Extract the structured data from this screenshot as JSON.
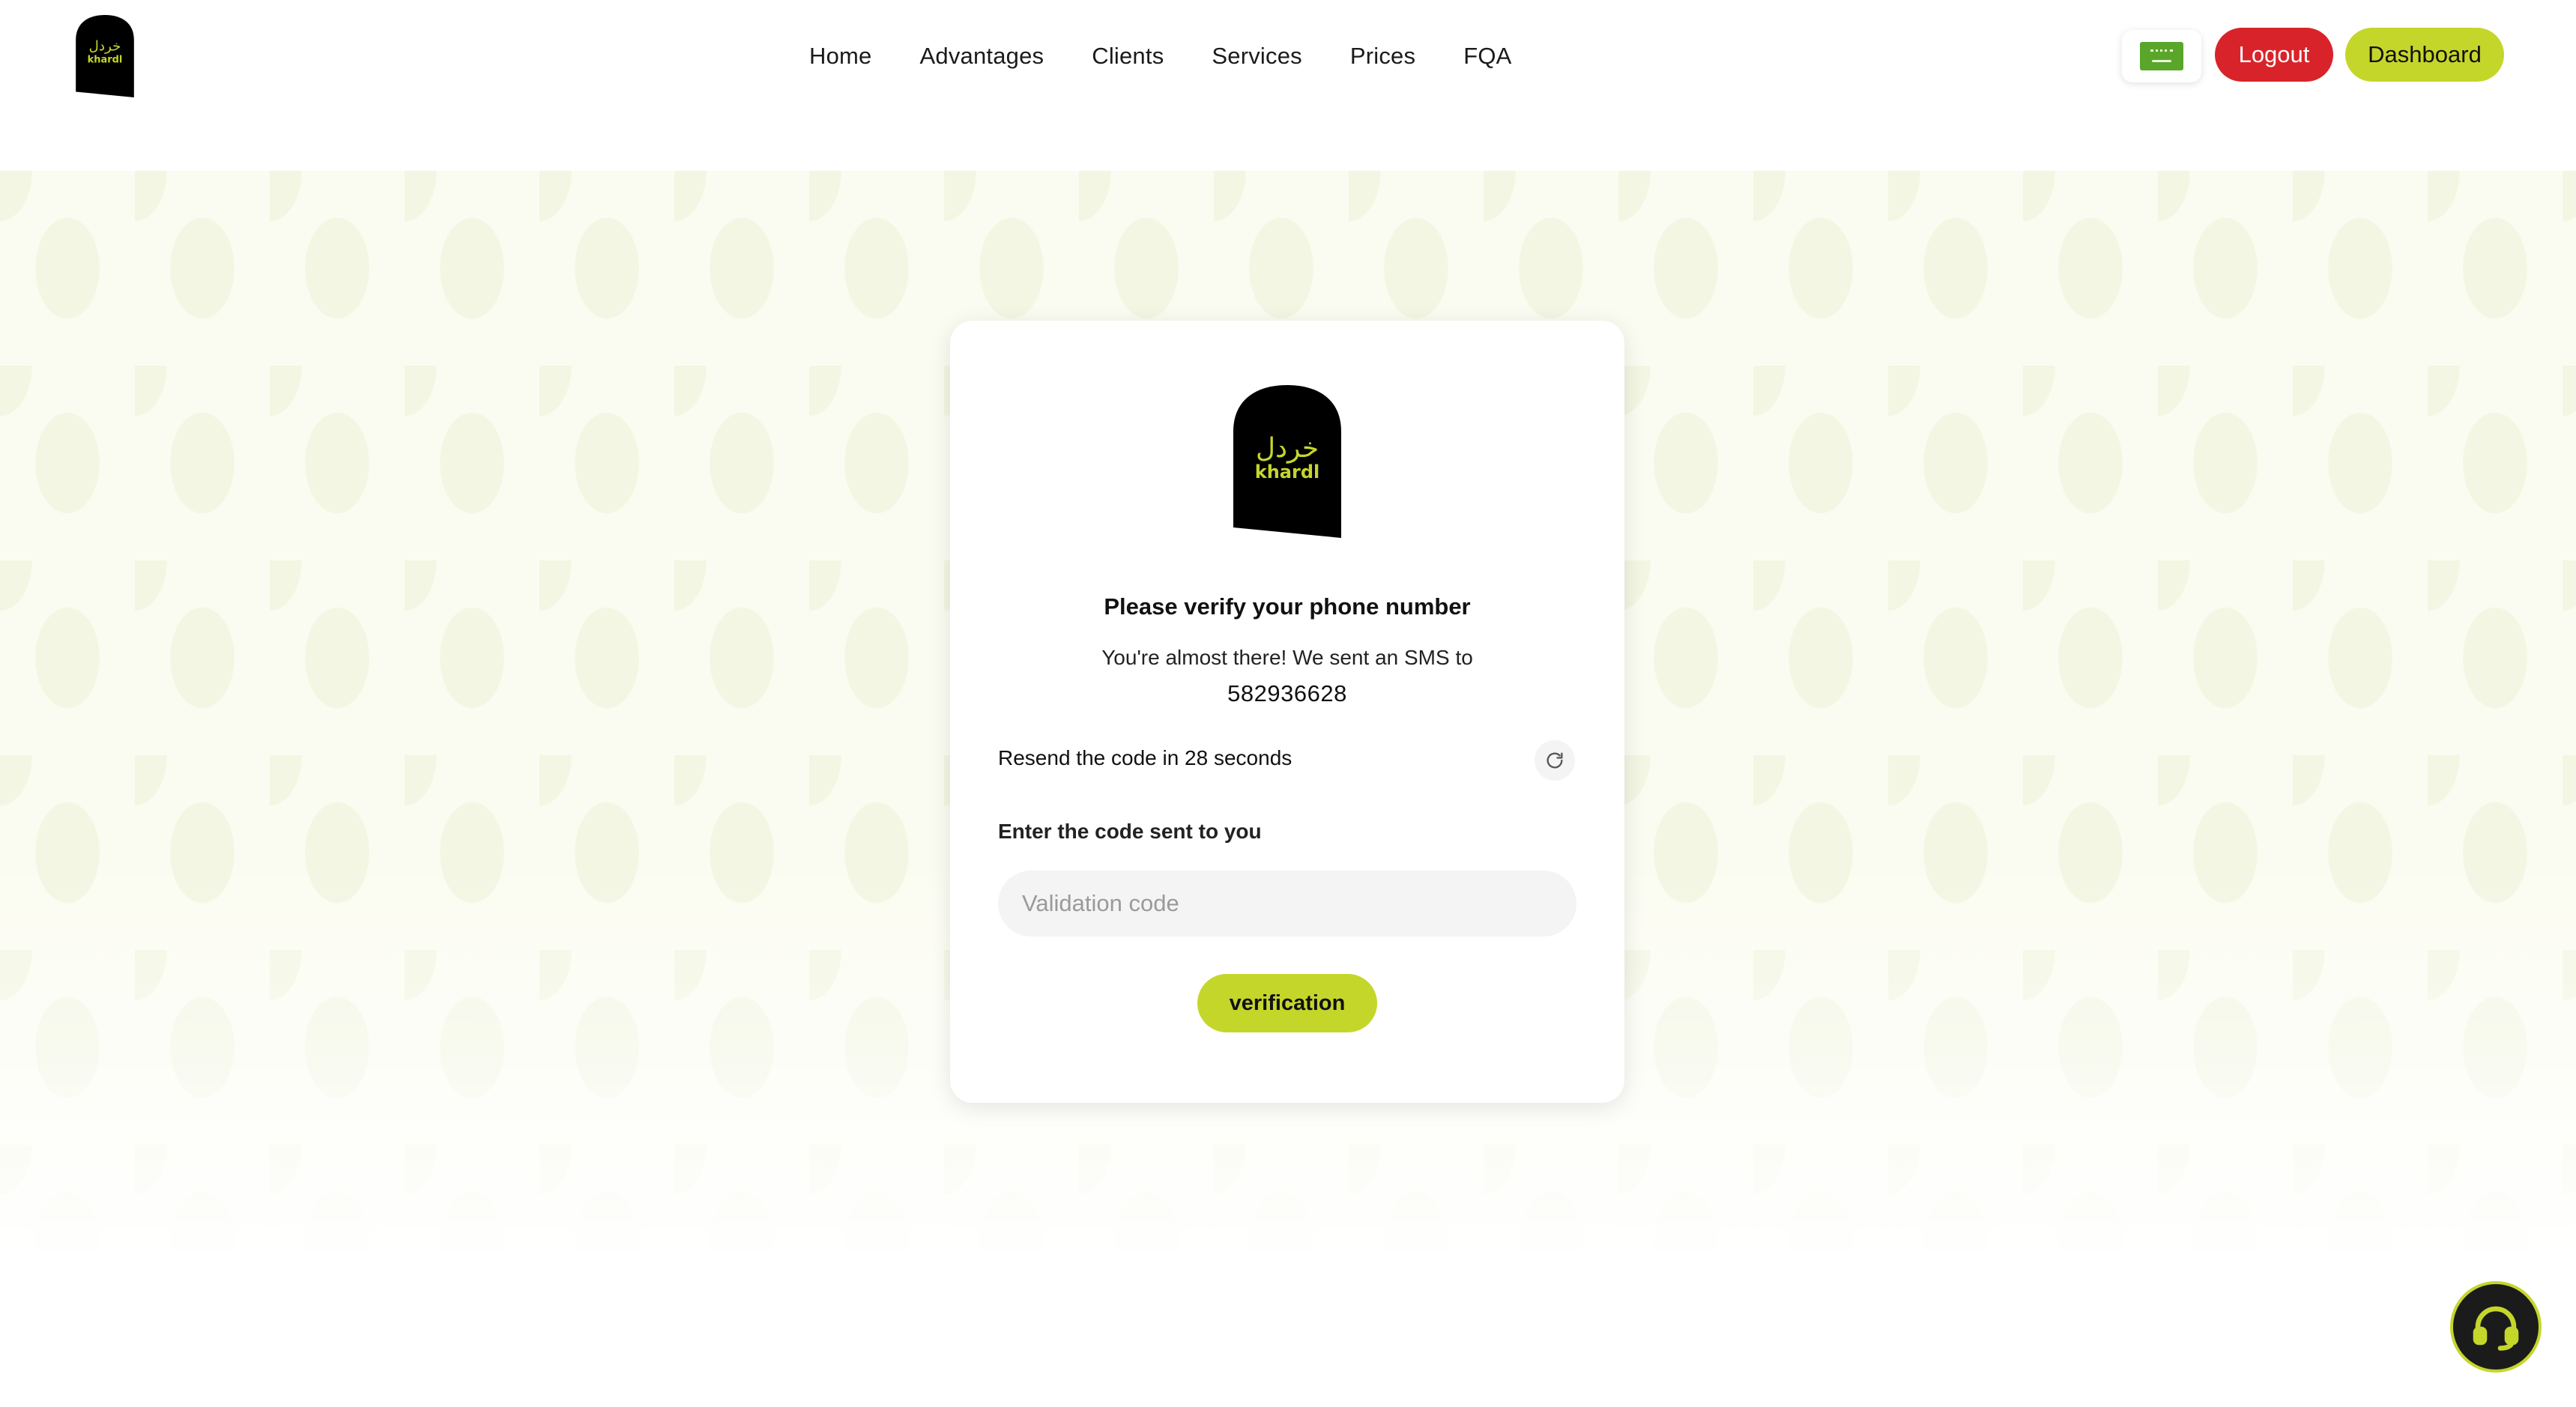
{
  "brand": {
    "name_arabic": "خردل",
    "name_latin": "khardl",
    "accent_color": "#c5d62b",
    "danger_color": "#d9232a"
  },
  "nav": {
    "items": [
      "Home",
      "Advantages",
      "Clients",
      "Services",
      "Prices",
      "FQA"
    ]
  },
  "header": {
    "language_icon": "saudi-flag-icon",
    "logout_label": "Logout",
    "dashboard_label": "Dashboard"
  },
  "verify": {
    "title": "Please verify your phone number",
    "subtitle": "You're almost there! We sent an SMS to",
    "phone": "582936628",
    "resend_text": "Resend the code in 28 seconds",
    "resend_icon": "refresh-icon",
    "code_label": "Enter the code sent to you",
    "code_placeholder": "Validation code",
    "code_value": "",
    "submit_label": "verification"
  },
  "support": {
    "icon": "headset-icon"
  }
}
